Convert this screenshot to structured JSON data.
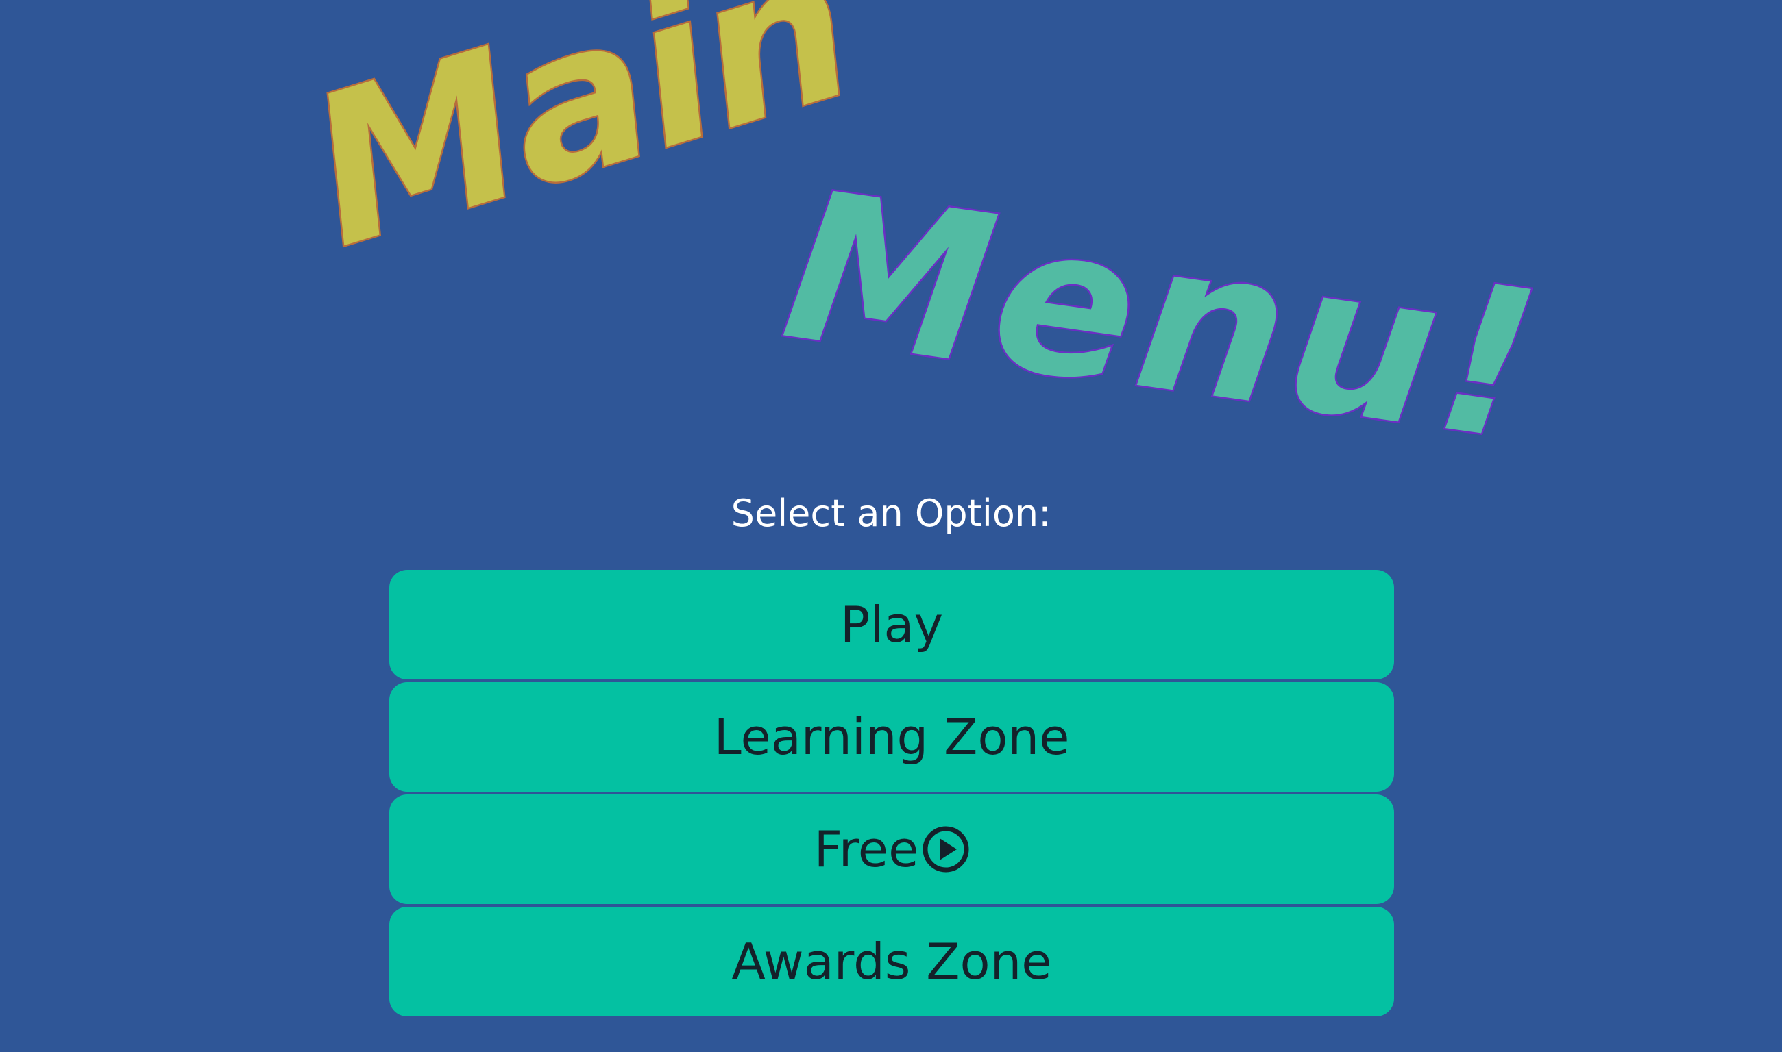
{
  "title": {
    "word1": "Main",
    "word2": "Menu!"
  },
  "colors": {
    "background": "#2f5697",
    "button": "#04c1a2",
    "button_text": "#14212a",
    "title_word1_fill": "#c5c14b",
    "title_word1_outline": "#b86d3c",
    "title_word2_fill": "#52bba3",
    "title_word2_outline": "#6b2fc4"
  },
  "prompt": "Select an Option:",
  "menu": {
    "items": [
      {
        "label": "Play"
      },
      {
        "label": "Learning Zone"
      },
      {
        "label": "Free",
        "icon": "play-circle-icon"
      },
      {
        "label": "Awards Zone"
      }
    ]
  }
}
